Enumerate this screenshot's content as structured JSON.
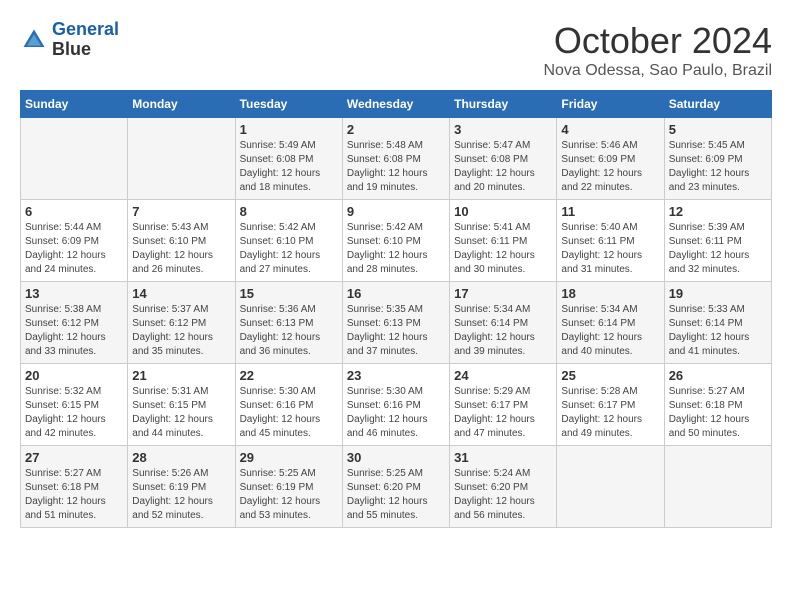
{
  "header": {
    "logo_line1": "General",
    "logo_line2": "Blue",
    "month": "October 2024",
    "location": "Nova Odessa, Sao Paulo, Brazil"
  },
  "weekdays": [
    "Sunday",
    "Monday",
    "Tuesday",
    "Wednesday",
    "Thursday",
    "Friday",
    "Saturday"
  ],
  "weeks": [
    [
      {
        "day": "",
        "sunrise": "",
        "sunset": "",
        "daylight": ""
      },
      {
        "day": "",
        "sunrise": "",
        "sunset": "",
        "daylight": ""
      },
      {
        "day": "1",
        "sunrise": "Sunrise: 5:49 AM",
        "sunset": "Sunset: 6:08 PM",
        "daylight": "Daylight: 12 hours and 18 minutes."
      },
      {
        "day": "2",
        "sunrise": "Sunrise: 5:48 AM",
        "sunset": "Sunset: 6:08 PM",
        "daylight": "Daylight: 12 hours and 19 minutes."
      },
      {
        "day": "3",
        "sunrise": "Sunrise: 5:47 AM",
        "sunset": "Sunset: 6:08 PM",
        "daylight": "Daylight: 12 hours and 20 minutes."
      },
      {
        "day": "4",
        "sunrise": "Sunrise: 5:46 AM",
        "sunset": "Sunset: 6:09 PM",
        "daylight": "Daylight: 12 hours and 22 minutes."
      },
      {
        "day": "5",
        "sunrise": "Sunrise: 5:45 AM",
        "sunset": "Sunset: 6:09 PM",
        "daylight": "Daylight: 12 hours and 23 minutes."
      }
    ],
    [
      {
        "day": "6",
        "sunrise": "Sunrise: 5:44 AM",
        "sunset": "Sunset: 6:09 PM",
        "daylight": "Daylight: 12 hours and 24 minutes."
      },
      {
        "day": "7",
        "sunrise": "Sunrise: 5:43 AM",
        "sunset": "Sunset: 6:10 PM",
        "daylight": "Daylight: 12 hours and 26 minutes."
      },
      {
        "day": "8",
        "sunrise": "Sunrise: 5:42 AM",
        "sunset": "Sunset: 6:10 PM",
        "daylight": "Daylight: 12 hours and 27 minutes."
      },
      {
        "day": "9",
        "sunrise": "Sunrise: 5:42 AM",
        "sunset": "Sunset: 6:10 PM",
        "daylight": "Daylight: 12 hours and 28 minutes."
      },
      {
        "day": "10",
        "sunrise": "Sunrise: 5:41 AM",
        "sunset": "Sunset: 6:11 PM",
        "daylight": "Daylight: 12 hours and 30 minutes."
      },
      {
        "day": "11",
        "sunrise": "Sunrise: 5:40 AM",
        "sunset": "Sunset: 6:11 PM",
        "daylight": "Daylight: 12 hours and 31 minutes."
      },
      {
        "day": "12",
        "sunrise": "Sunrise: 5:39 AM",
        "sunset": "Sunset: 6:11 PM",
        "daylight": "Daylight: 12 hours and 32 minutes."
      }
    ],
    [
      {
        "day": "13",
        "sunrise": "Sunrise: 5:38 AM",
        "sunset": "Sunset: 6:12 PM",
        "daylight": "Daylight: 12 hours and 33 minutes."
      },
      {
        "day": "14",
        "sunrise": "Sunrise: 5:37 AM",
        "sunset": "Sunset: 6:12 PM",
        "daylight": "Daylight: 12 hours and 35 minutes."
      },
      {
        "day": "15",
        "sunrise": "Sunrise: 5:36 AM",
        "sunset": "Sunset: 6:13 PM",
        "daylight": "Daylight: 12 hours and 36 minutes."
      },
      {
        "day": "16",
        "sunrise": "Sunrise: 5:35 AM",
        "sunset": "Sunset: 6:13 PM",
        "daylight": "Daylight: 12 hours and 37 minutes."
      },
      {
        "day": "17",
        "sunrise": "Sunrise: 5:34 AM",
        "sunset": "Sunset: 6:14 PM",
        "daylight": "Daylight: 12 hours and 39 minutes."
      },
      {
        "day": "18",
        "sunrise": "Sunrise: 5:34 AM",
        "sunset": "Sunset: 6:14 PM",
        "daylight": "Daylight: 12 hours and 40 minutes."
      },
      {
        "day": "19",
        "sunrise": "Sunrise: 5:33 AM",
        "sunset": "Sunset: 6:14 PM",
        "daylight": "Daylight: 12 hours and 41 minutes."
      }
    ],
    [
      {
        "day": "20",
        "sunrise": "Sunrise: 5:32 AM",
        "sunset": "Sunset: 6:15 PM",
        "daylight": "Daylight: 12 hours and 42 minutes."
      },
      {
        "day": "21",
        "sunrise": "Sunrise: 5:31 AM",
        "sunset": "Sunset: 6:15 PM",
        "daylight": "Daylight: 12 hours and 44 minutes."
      },
      {
        "day": "22",
        "sunrise": "Sunrise: 5:30 AM",
        "sunset": "Sunset: 6:16 PM",
        "daylight": "Daylight: 12 hours and 45 minutes."
      },
      {
        "day": "23",
        "sunrise": "Sunrise: 5:30 AM",
        "sunset": "Sunset: 6:16 PM",
        "daylight": "Daylight: 12 hours and 46 minutes."
      },
      {
        "day": "24",
        "sunrise": "Sunrise: 5:29 AM",
        "sunset": "Sunset: 6:17 PM",
        "daylight": "Daylight: 12 hours and 47 minutes."
      },
      {
        "day": "25",
        "sunrise": "Sunrise: 5:28 AM",
        "sunset": "Sunset: 6:17 PM",
        "daylight": "Daylight: 12 hours and 49 minutes."
      },
      {
        "day": "26",
        "sunrise": "Sunrise: 5:27 AM",
        "sunset": "Sunset: 6:18 PM",
        "daylight": "Daylight: 12 hours and 50 minutes."
      }
    ],
    [
      {
        "day": "27",
        "sunrise": "Sunrise: 5:27 AM",
        "sunset": "Sunset: 6:18 PM",
        "daylight": "Daylight: 12 hours and 51 minutes."
      },
      {
        "day": "28",
        "sunrise": "Sunrise: 5:26 AM",
        "sunset": "Sunset: 6:19 PM",
        "daylight": "Daylight: 12 hours and 52 minutes."
      },
      {
        "day": "29",
        "sunrise": "Sunrise: 5:25 AM",
        "sunset": "Sunset: 6:19 PM",
        "daylight": "Daylight: 12 hours and 53 minutes."
      },
      {
        "day": "30",
        "sunrise": "Sunrise: 5:25 AM",
        "sunset": "Sunset: 6:20 PM",
        "daylight": "Daylight: 12 hours and 55 minutes."
      },
      {
        "day": "31",
        "sunrise": "Sunrise: 5:24 AM",
        "sunset": "Sunset: 6:20 PM",
        "daylight": "Daylight: 12 hours and 56 minutes."
      },
      {
        "day": "",
        "sunrise": "",
        "sunset": "",
        "daylight": ""
      },
      {
        "day": "",
        "sunrise": "",
        "sunset": "",
        "daylight": ""
      }
    ]
  ]
}
